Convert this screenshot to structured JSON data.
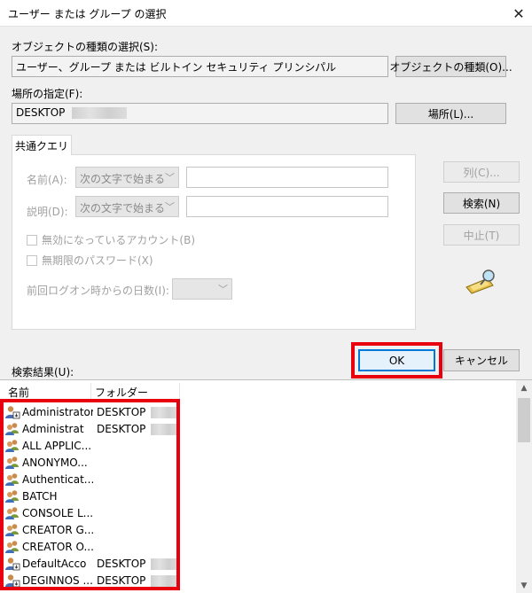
{
  "window": {
    "title": "ユーザー または グループ の選択",
    "close_glyph": "✕"
  },
  "object_type": {
    "label": "オブジェクトの種類の選択(S):",
    "value": "ユーザー、グループ または ビルトイン セキュリティ プリンシパル",
    "button": "オブジェクトの種類(O)..."
  },
  "location": {
    "label": "場所の指定(F):",
    "value": "DESKTOP",
    "button": "場所(L)..."
  },
  "query": {
    "tab": "共通クエリ",
    "name_label": "名前(A):",
    "name_combo": "次の文字で始まる",
    "desc_label": "説明(D):",
    "desc_combo": "次の文字で始まる",
    "disabled_accounts": "無効になっているアカウント(B)",
    "no_expire_password": "無期限のパスワード(X)",
    "last_logon_label": "前回ログオン時からの日数(I):"
  },
  "side_buttons": {
    "columns": "列(C)...",
    "search": "検索(N)",
    "stop": "中止(T)"
  },
  "dialog_buttons": {
    "ok": "OK",
    "cancel": "キャンセル"
  },
  "results": {
    "label": "検索結果(U):",
    "headers": {
      "name": "名前",
      "folder": "フォルダー"
    },
    "rows": [
      {
        "name": "Administrator",
        "folder": "DESKTOP",
        "icon": "user-icon"
      },
      {
        "name": "Administrat",
        "folder": "DESKTOP",
        "icon": "group-icon"
      },
      {
        "name": "ALL APPLIC...",
        "folder": "",
        "icon": "group-icon"
      },
      {
        "name": "ANONYMO...",
        "folder": "",
        "icon": "group-icon"
      },
      {
        "name": "Authenticat...",
        "folder": "",
        "icon": "group-icon"
      },
      {
        "name": "BATCH",
        "folder": "",
        "icon": "group-icon"
      },
      {
        "name": "CONSOLE L...",
        "folder": "",
        "icon": "group-icon"
      },
      {
        "name": "CREATOR G...",
        "folder": "",
        "icon": "group-icon"
      },
      {
        "name": "CREATOR O...",
        "folder": "",
        "icon": "group-icon"
      },
      {
        "name": "DefaultAcco",
        "folder": "DESKTOP",
        "icon": "user-icon"
      },
      {
        "name": "DEGINNOS ...",
        "folder": "DESKTOP",
        "icon": "user-icon"
      }
    ]
  },
  "colors": {
    "highlight": "#e8000f",
    "focus": "#0078d7"
  }
}
